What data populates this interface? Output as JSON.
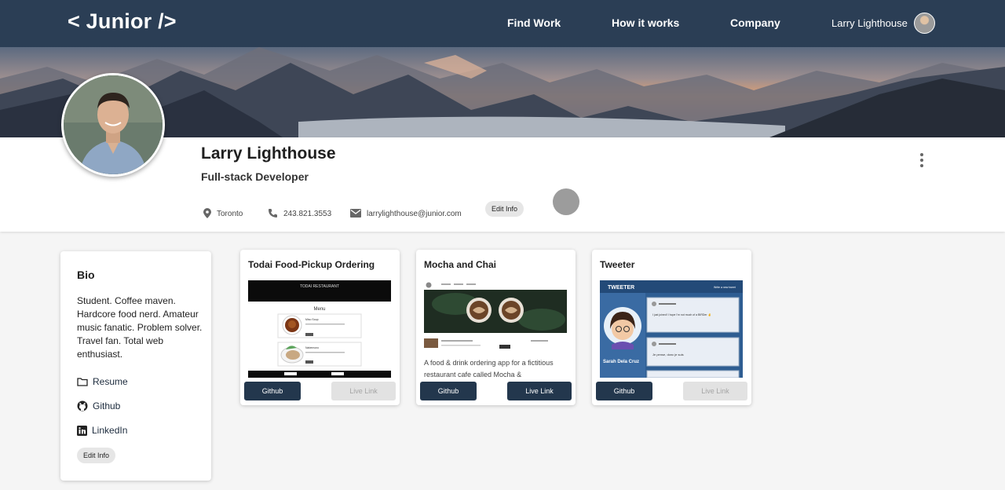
{
  "nav": {
    "logo": "< Junior />",
    "links": [
      "Find Work",
      "How it works",
      "Company"
    ],
    "user_name": "Larry Lighthouse"
  },
  "profile": {
    "name": "Larry Lighthouse",
    "title": "Full-stack Developer",
    "location": "Toronto",
    "phone": "243.821.3553",
    "email": "larrylighthouse@junior.com",
    "edit_label": "Edit Info"
  },
  "bio": {
    "heading": "Bio",
    "text": "Student. Coffee maven. Hardcore food nerd. Amateur music fanatic. Problem solver. Travel fan. Total web enthusiast.",
    "links": [
      "Resume",
      "Github",
      "LinkedIn"
    ],
    "edit_label": "Edit Info"
  },
  "projects": [
    {
      "title": "Todai Food-Pickup Ordering",
      "github_label": "Github",
      "live_label": "Live Link",
      "live_enabled": false,
      "thumb": {
        "brand": "TODAI RESTAURANT",
        "menu_title": "Menu",
        "item1": "Miso Soup",
        "item2": "Nabemono"
      }
    },
    {
      "title": "Mocha and Chai",
      "github_label": "Github",
      "live_label": "Live Link",
      "live_enabled": true,
      "description": "A food & drink ordering app for a fictitious restaurant cafe called Mocha &"
    },
    {
      "title": "Tweeter",
      "github_label": "Github",
      "live_label": "Live Link",
      "live_enabled": false,
      "thumb": {
        "brand": "TWEETER",
        "compose": "Write a new tweet",
        "user": "Sarah Dela Cruz",
        "tweet1": "I just joined! I hope I'm not much of a BIRDer ✌",
        "tweet2": "Je pense, donc je suis"
      }
    }
  ],
  "colors": {
    "nav_bg": "#2b3e55",
    "button_bg": "#23374d",
    "disabled_bg": "#e2e2e2"
  }
}
